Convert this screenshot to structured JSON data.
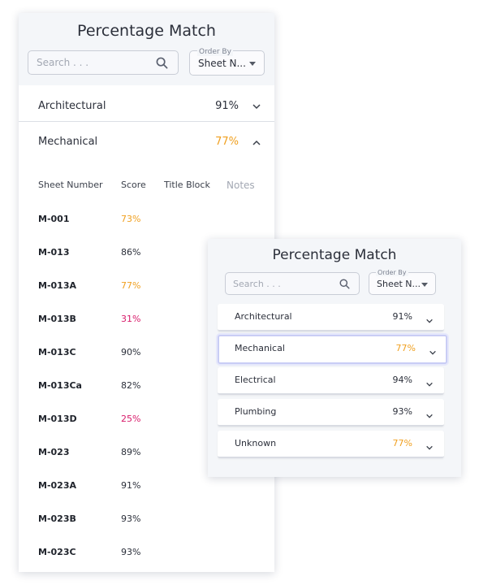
{
  "left_panel": {
    "title": "Percentage Match",
    "search": {
      "placeholder": "Search . . ."
    },
    "order_by": {
      "caption": "Order By",
      "value": "Sheet N..."
    },
    "groups": [
      {
        "label": "Architectural",
        "percent": "91%",
        "color": "dark",
        "expanded": false
      },
      {
        "label": "Mechanical",
        "percent": "77%",
        "color": "orange",
        "expanded": true
      }
    ],
    "table": {
      "headers": {
        "sheet_number": "Sheet Number",
        "score": "Score",
        "title_block": "Title Block",
        "notes": "Notes"
      },
      "rows": [
        {
          "sheet": "M-001",
          "score": "73%",
          "color": "orange"
        },
        {
          "sheet": "M-013",
          "score": "86%",
          "color": "dark"
        },
        {
          "sheet": "M-013A",
          "score": "77%",
          "color": "orange"
        },
        {
          "sheet": "M-013B",
          "score": "31%",
          "color": "red"
        },
        {
          "sheet": "M-013C",
          "score": "90%",
          "color": "dark"
        },
        {
          "sheet": "M-013Ca",
          "score": "82%",
          "color": "dark"
        },
        {
          "sheet": "M-013D",
          "score": "25%",
          "color": "red"
        },
        {
          "sheet": "M-023",
          "score": "89%",
          "color": "dark"
        },
        {
          "sheet": "M-023A",
          "score": "91%",
          "color": "dark"
        },
        {
          "sheet": "M-023B",
          "score": "93%",
          "color": "dark"
        },
        {
          "sheet": "M-023C",
          "score": "93%",
          "color": "dark"
        }
      ]
    }
  },
  "right_panel": {
    "title": "Percentage Match",
    "search": {
      "placeholder": "Search . . ."
    },
    "order_by": {
      "caption": "Order By",
      "value": "Sheet N..."
    },
    "groups": [
      {
        "label": "Architectural",
        "percent": "91%",
        "color": "dark",
        "selected": false
      },
      {
        "label": "Mechanical",
        "percent": "77%",
        "color": "orange",
        "selected": true
      },
      {
        "label": "Electrical",
        "percent": "94%",
        "color": "dark",
        "selected": false
      },
      {
        "label": "Plumbing",
        "percent": "93%",
        "color": "dark",
        "selected": false
      },
      {
        "label": "Unknown",
        "percent": "77%",
        "color": "orange",
        "selected": false
      }
    ]
  },
  "colors": {
    "dark": "#2b2f3a",
    "orange": "#f0a020",
    "red": "#d81b6a",
    "selected_border": "#c9cdf5"
  },
  "icons": {
    "search": "search-icon",
    "caret": "caret-down-icon",
    "chevron_down": "chevron-down-icon",
    "chevron_up": "chevron-up-icon"
  }
}
